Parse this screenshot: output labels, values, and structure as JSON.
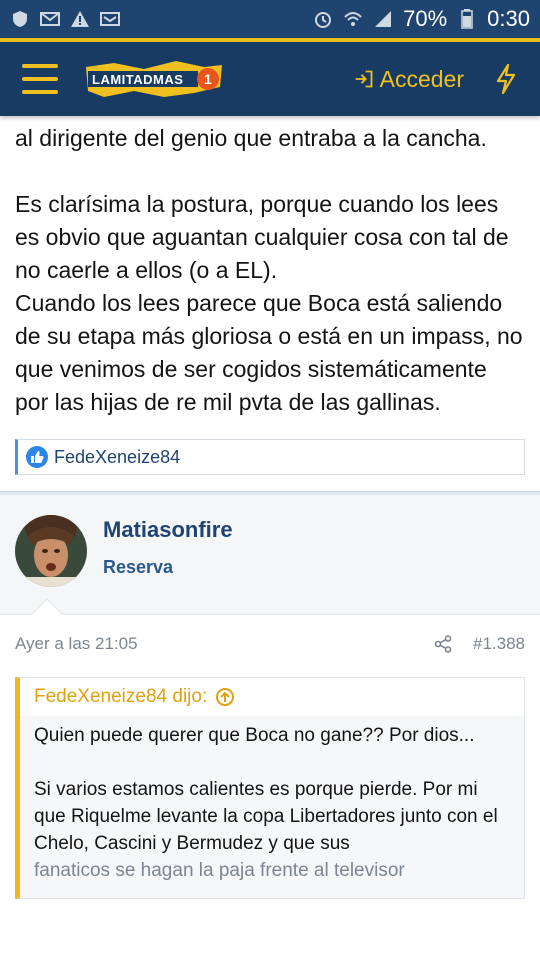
{
  "status_bar": {
    "battery": "70%",
    "time": "0:30"
  },
  "header": {
    "logo_text": "LAMITADMAS",
    "logo_number": "1",
    "login_label": "Acceder"
  },
  "post": {
    "paragraphs_top": [
      "al dirigente del genio que entraba a la cancha."
    ],
    "paragraphs_bottom": [
      "Es clarísima la postura, porque cuando los lees es obvio que aguantan cualquier cosa con tal de no caerle a ellos (o a EL).",
      "Cuando los lees parece que Boca está saliendo de su etapa más gloriosa o está en un impass, no que venimos de ser cogidos sistemáticamente por las hijas de re mil pvta de las gallinas."
    ],
    "reaction_user": "FedeXeneize84"
  },
  "reply": {
    "username": "Matiasonfire",
    "user_title": "Reserva",
    "timestamp": "Ayer a las 21:05",
    "post_number": "#1.388",
    "quote": {
      "author": "FedeXeneize84 dijo:",
      "line1": "Quien puede querer que Boca no gane?? Por dios...",
      "line2": "Si varios estamos calientes es porque pierde. Por mi que Riquelme levante la copa Libertadores junto con el Chelo, Cascini y Bermudez y que sus",
      "line3": "fanaticos se hagan la paja frente al televisor"
    }
  },
  "colors": {
    "header_bg": "#183b63",
    "accent_yellow": "#f0c020",
    "link_blue": "#1f4470"
  }
}
